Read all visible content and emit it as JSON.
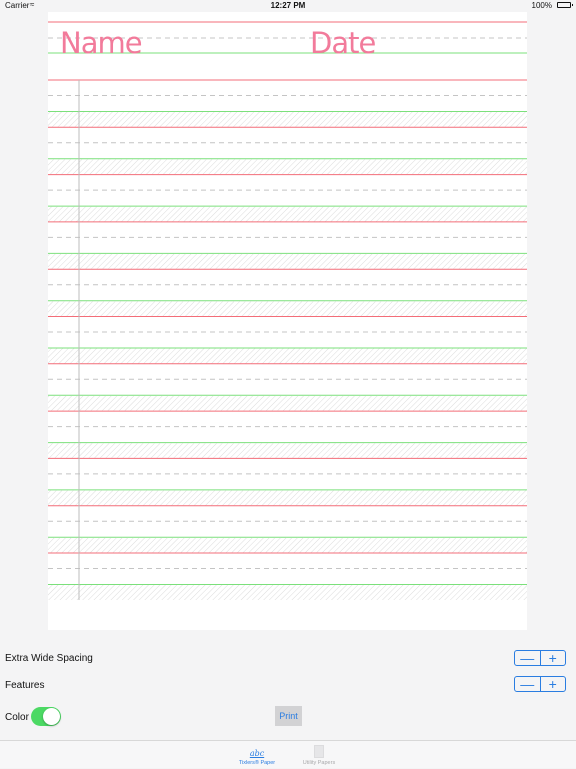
{
  "status_bar": {
    "carrier": "Carrier",
    "wifi_icon": "wifi-icon",
    "time": "12:27 PM",
    "battery_percent": "100%",
    "battery_icon": "battery-icon"
  },
  "paper": {
    "name_label": "Name",
    "date_label": "Date",
    "line_rows": 11,
    "colors": {
      "headline": "#f36d78",
      "midline": "#c4c4c4",
      "baseline": "#7be07b",
      "margin": "#bdbdbd",
      "name_text": "#f27b9b",
      "date_text": "#f27b9b"
    }
  },
  "controls": {
    "extra_wide_spacing_label": "Extra Wide Spacing",
    "features_label": "Features",
    "color_label": "Color",
    "color_on": true,
    "print_label": "Print",
    "minus_glyph": "—",
    "plus_glyph": "+"
  },
  "tab_bar": {
    "tabs": [
      {
        "label": "Tixlers® Paper",
        "icon": "abc-icon",
        "glyph": "abc",
        "active": true
      },
      {
        "label": "Utility Papers",
        "icon": "page-icon",
        "active": false
      }
    ]
  },
  "colors": {
    "accent": "#2a7de1",
    "toggle_on": "#4cd964"
  }
}
